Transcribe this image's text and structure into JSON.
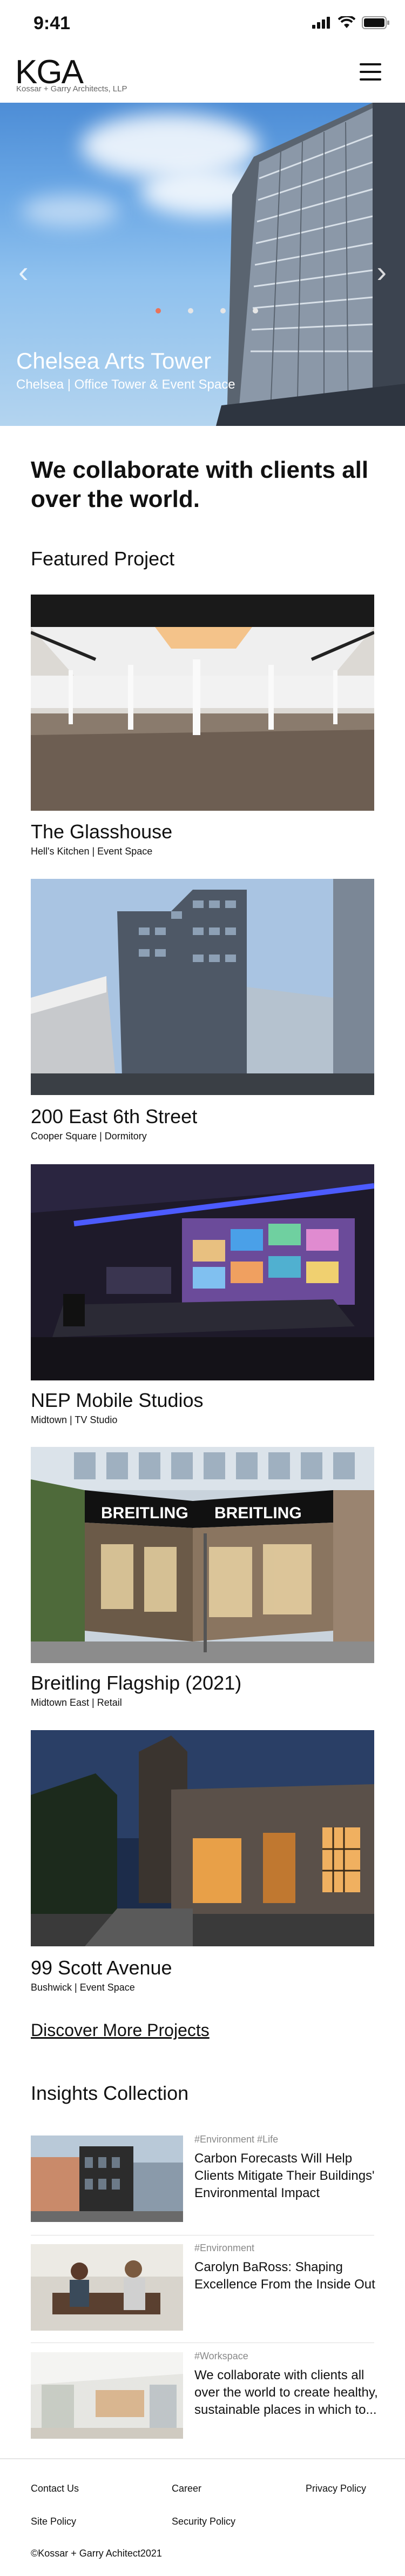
{
  "status_bar": {
    "time": "9:41"
  },
  "header": {
    "logo": "KGA",
    "logo_sub": "Kossar + Garry Architects, LLP"
  },
  "hero": {
    "title": "Chelsea Arts Tower",
    "subtitle": "Chelsea | Office Tower & Event Space",
    "slide_count": 4,
    "active_slide": 1
  },
  "intro": "We collaborate with clients all over the world.",
  "featured_heading": "Featured Project",
  "projects": [
    {
      "title": "The Glasshouse",
      "subtitle": "Hell's Kitchen | Event Space"
    },
    {
      "title": "200 East 6th Street",
      "subtitle": "Cooper Square | Dormitory"
    },
    {
      "title": "NEP Mobile Studios",
      "subtitle": "Midtown | TV Studio"
    },
    {
      "title": "Breitling Flagship (2021)",
      "subtitle": "Midtown East | Retail"
    },
    {
      "title": "99 Scott Avenue",
      "subtitle": "Bushwick | Event Space"
    }
  ],
  "storefront_signs": [
    "BREITLING",
    "BREITLING"
  ],
  "discover_label": "Discover More Projects",
  "insights_heading": "Insights Collection",
  "insights": [
    {
      "tags": "#Environment  #Life",
      "title": "Carbon Forecasts Will Help Clients Mitigate Their Buildings' Environmental Impact"
    },
    {
      "tags": "#Environment",
      "title": "Carolyn BaRoss: Shaping Excellence From the Inside Out"
    },
    {
      "tags": "#Workspace",
      "title": "We collaborate with clients all over the world to create healthy, sustainable places in which to..."
    }
  ],
  "footer": {
    "contact": "Contact Us",
    "career": "Career",
    "privacy": "Privacy Policy",
    "site": "Site Policy",
    "security": "Security Policy",
    "copyright": "©Kossar + Garry Achitect2021"
  }
}
